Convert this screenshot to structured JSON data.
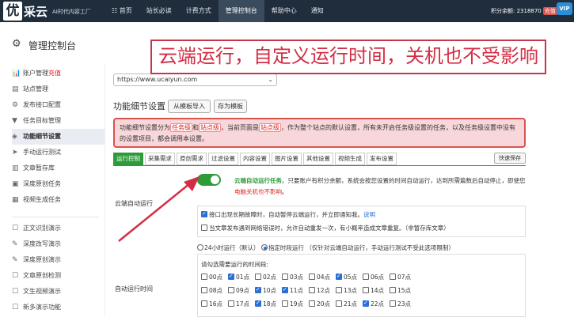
{
  "brand": {
    "logo_char": "优",
    "name": "采云",
    "slogan": "AI时代内容工厂"
  },
  "nav": {
    "items": [
      {
        "label": "☷ 首页",
        "active": false
      },
      {
        "label": "站长必读",
        "active": false
      },
      {
        "label": "计费方式",
        "active": false
      },
      {
        "label": "管理控制台",
        "active": true
      },
      {
        "label": "帮助中心",
        "active": false
      },
      {
        "label": "通知",
        "active": false
      }
    ]
  },
  "account": {
    "points_label": "积分余额: 2318870",
    "recharge": "充值",
    "vip": "VIP"
  },
  "page": {
    "title": "管理控制台"
  },
  "banner": {
    "text": "云端运行，自定义运行时间，关机也不受影响"
  },
  "sidebar": {
    "items": [
      {
        "icon": "📊",
        "label": "账户管理",
        "extra": "充值"
      },
      {
        "icon": "▤",
        "label": "站点管理"
      },
      {
        "icon": "⚙",
        "label": "发布接口配置"
      },
      {
        "icon": "▼",
        "label": "任务目标管理"
      },
      {
        "icon": "◈",
        "label": "功能细节设置"
      },
      {
        "icon": "➤",
        "label": "手动运行测试"
      },
      {
        "icon": "▥",
        "label": "文章暂存库"
      },
      {
        "icon": "▣",
        "label": "深度原创任务"
      },
      {
        "icon": "▦",
        "label": "视频生成任务"
      },
      {
        "icon": "☐",
        "label": "正文识别演示"
      },
      {
        "icon": "✎",
        "label": "深度改写演示"
      },
      {
        "icon": "✎",
        "label": "深度原创演示"
      },
      {
        "icon": "☐",
        "label": "文章原创检测"
      },
      {
        "icon": "☐",
        "label": "文生视频演示"
      },
      {
        "icon": "☐",
        "label": "新多演示功能"
      }
    ]
  },
  "site": {
    "url": "https://www.ucaiyun.com"
  },
  "section": {
    "title": "功能细节设置",
    "btn_import": "从模板导入",
    "btn_save_template": "存为模板"
  },
  "notice": {
    "p1": "功能细节设置分为",
    "tag1": "任务级",
    "p2": "和",
    "tag2": "站点级",
    "p3": "，当前页面是",
    "tag3": "站点级",
    "p4": "，作为整个站点的默认设置，所有未开启任务级设置的任务，以及任务级设置中没有的设置项目，都会调用本设置。"
  },
  "tabs": [
    "运行控制",
    "采集需求",
    "原创需求",
    "过滤设置",
    "内容设置",
    "图片设置",
    "其他设置",
    "视频生成",
    "发布设置"
  ],
  "quick_save": "快速保存",
  "auto_run": {
    "label": "云端自动运行",
    "title": "云端自动运行任务",
    "desc": "。只要账户有积分余额，系统会按您设置的时间自动运行，达到所需篇数后自动停止，即使您",
    "red": "电脑关机也不影响",
    "end": "。"
  },
  "options": {
    "opt1": "接口出现长期故障时，自动暂停云端运行，并立即通知我。",
    "opt1_link": "说明",
    "opt2": "当文章发布遇到网络错误时，允许自动重发一次，有小概率造成文章重复。（非暂存库文章）"
  },
  "schedule": {
    "label": "自动运行时间",
    "radio1": "24小时运行（默认）",
    "radio2": "指定时段运行",
    "radio2_note": "（仅针对云端自动运行，手动运行测试不受此选项限制）",
    "prompt": "请勾选需要运行的时间段:",
    "hours": [
      {
        "label": "00点",
        "on": false
      },
      {
        "label": "01点",
        "on": true
      },
      {
        "label": "02点",
        "on": false
      },
      {
        "label": "03点",
        "on": false
      },
      {
        "label": "04点",
        "on": false
      },
      {
        "label": "05点",
        "on": true
      },
      {
        "label": "06点",
        "on": false
      },
      {
        "label": "07点",
        "on": false
      },
      {
        "label": "08点",
        "on": false
      },
      {
        "label": "09点",
        "on": false
      },
      {
        "label": "10点",
        "on": true
      },
      {
        "label": "11点",
        "on": true
      },
      {
        "label": "12点",
        "on": false
      },
      {
        "label": "13点",
        "on": false
      },
      {
        "label": "14点",
        "on": false
      },
      {
        "label": "15点",
        "on": false
      },
      {
        "label": "16点",
        "on": false
      },
      {
        "label": "17点",
        "on": false
      },
      {
        "label": "18点",
        "on": true
      },
      {
        "label": "19点",
        "on": false
      },
      {
        "label": "20点",
        "on": false
      },
      {
        "label": "21点",
        "on": false
      },
      {
        "label": "22点",
        "on": true
      },
      {
        "label": "23点",
        "on": false
      }
    ]
  },
  "colors": {
    "accent": "#2e9b3a",
    "banner": "#d32d44",
    "topbar": "#1f2d3d"
  }
}
